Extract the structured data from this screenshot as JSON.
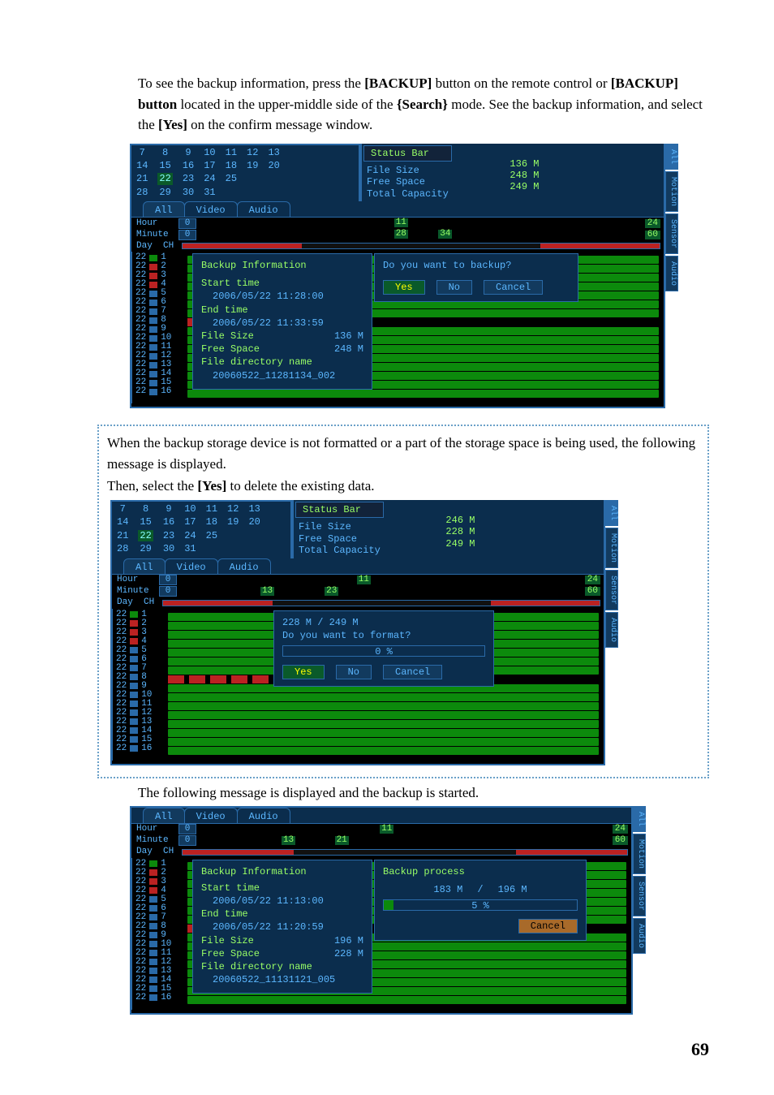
{
  "intro": {
    "line1a": "To see the backup information, press the ",
    "b1": "[BACKUP]",
    "line1b": " button on the remote control or ",
    "b2": "[BACKUP] button",
    "line1c": " located in the upper-middle side of the ",
    "b3": "{Search}",
    "line1d": " mode. See the backup information, and select the ",
    "b4": "[Yes]",
    "line1e": " on the confirm message window."
  },
  "dvr_common": {
    "cal_rows": [
      [
        "7",
        "8",
        "9",
        "10",
        "11",
        "12",
        "13"
      ],
      [
        "14",
        "15",
        "16",
        "17",
        "18",
        "19",
        "20"
      ],
      [
        "21",
        "22",
        "23",
        "24",
        "25"
      ],
      [
        "28",
        "29",
        "30",
        "31"
      ]
    ],
    "cal_active": "22",
    "status_bar_label": "Status Bar",
    "info_labels": {
      "file_size": "File Size",
      "free_space": "Free Space",
      "total_capacity": "Total Capacity"
    },
    "tabs": {
      "all": "All",
      "video": "Video",
      "audio": "Audio"
    },
    "axis": {
      "hour": "Hour",
      "minute": "Minute",
      "day": "Day",
      "ch": "CH",
      "zero": "0",
      "end_24": "24",
      "end_60": "60"
    },
    "right_tabs": [
      "All",
      "Motion",
      "Sensor",
      "Audio"
    ],
    "channels": [
      "1",
      "2",
      "3",
      "4",
      "5",
      "6",
      "7",
      "8",
      "9",
      "10",
      "11",
      "12",
      "13",
      "14",
      "15",
      "16"
    ],
    "day_value": "22"
  },
  "shot1": {
    "info": {
      "file_size": "136 M",
      "free_space": "248 M",
      "total_capacity": "249 M"
    },
    "hour_tick": "11",
    "minute_ticks": [
      "28",
      "34"
    ],
    "backup_info": {
      "title": "Backup Information",
      "start_label": "Start time",
      "start_value": "2006/05/22  11:28:00",
      "end_label": "End time",
      "end_value": "2006/05/22  11:33:59",
      "file_size_label": "File Size",
      "file_size_value": "136 M",
      "free_space_label": "Free Space",
      "free_space_value": "248 M",
      "dir_label": "File directory name",
      "dir_value": "20060522_11281134_002"
    },
    "confirm": {
      "text": "Do you want to backup?",
      "yes": "Yes",
      "no": "No",
      "cancel": "Cancel"
    }
  },
  "note_between_1a": "When the backup storage device is not formatted or a part of the storage space is being used, the following message is displayed.",
  "note_between_1b_a": "Then, select the ",
  "note_between_1b_b": "[Yes]",
  "note_between_1b_c": " to delete the existing data.",
  "shot2": {
    "info": {
      "file_size": "246 M",
      "free_space": "228 M",
      "total_capacity": "249 M"
    },
    "hour_tick": "11",
    "minute_ticks": [
      "13",
      "23"
    ],
    "format": {
      "line1": "228 M / 249 M",
      "line2": "Do you want to format?",
      "percent": "0 %",
      "yes": "Yes",
      "no": "No",
      "cancel": "Cancel"
    }
  },
  "between2": "The following message is displayed and the backup is started.",
  "shot3": {
    "hour_tick": "11",
    "minute_ticks": [
      "13",
      "21"
    ],
    "backup_info": {
      "title": "Backup Information",
      "start_label": "Start time",
      "start_value": "2006/05/22  11:13:00",
      "end_label": "End time",
      "end_value": "2006/05/22  11:20:59",
      "file_size_label": "File Size",
      "file_size_value": "196 M",
      "free_space_label": "Free Space",
      "free_space_value": "228 M",
      "dir_label": "File directory name",
      "dir_value": "20060522_11131121_005"
    },
    "process": {
      "title": "Backup process",
      "done": "183 M",
      "sep": "/",
      "total": "196 M",
      "percent": "5 %",
      "cancel": "Cancel"
    }
  },
  "page_number": "69"
}
